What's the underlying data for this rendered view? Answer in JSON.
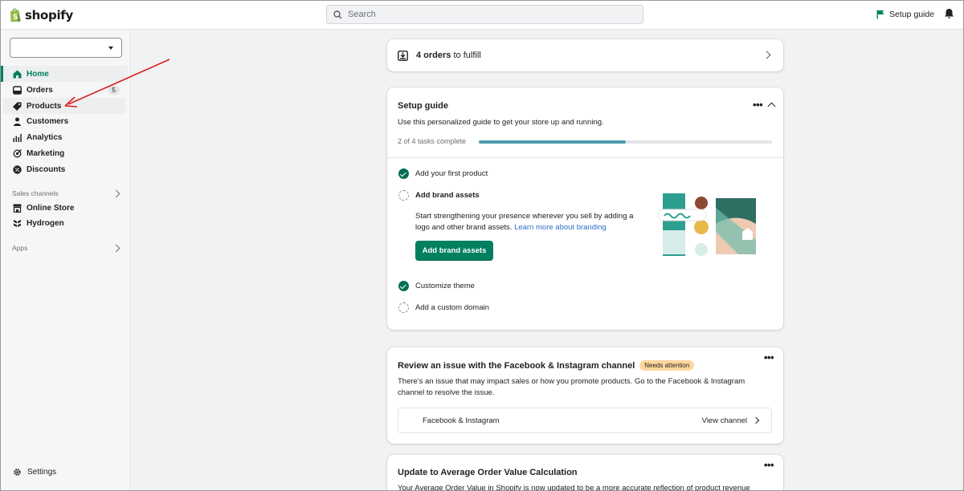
{
  "topbar": {
    "brand": "shopify",
    "search_placeholder": "Search",
    "setup_guide_label": "Setup guide"
  },
  "sidebar": {
    "items": [
      {
        "label": "Home",
        "icon": "home-icon",
        "active": true
      },
      {
        "label": "Orders",
        "icon": "orders-icon",
        "badge": "5"
      },
      {
        "label": "Products",
        "icon": "tag-icon"
      },
      {
        "label": "Customers",
        "icon": "person-icon"
      },
      {
        "label": "Analytics",
        "icon": "bar-chart-icon"
      },
      {
        "label": "Marketing",
        "icon": "target-icon"
      },
      {
        "label": "Discounts",
        "icon": "discount-icon"
      }
    ],
    "sales_channels_label": "Sales channels",
    "channels": [
      {
        "label": "Online Store",
        "icon": "store-icon"
      },
      {
        "label": "Hydrogen",
        "icon": "hydrogen-icon"
      }
    ],
    "apps_label": "Apps",
    "settings_label": "Settings"
  },
  "orders_card": {
    "count_text": "4 orders",
    "suffix": "to fulfill"
  },
  "setup_guide": {
    "title": "Setup guide",
    "description": "Use this personalized guide to get your store up and running.",
    "progress_text": "2 of 4 tasks complete",
    "progress_fraction": 0.5,
    "tasks": [
      {
        "label": "Add your first product",
        "done": true
      },
      {
        "label": "Add brand assets",
        "done": false
      },
      {
        "label": "Customize theme",
        "done": true
      },
      {
        "label": "Add a custom domain",
        "done": false
      }
    ],
    "brand_assets_desc": "Start strengthening your presence wherever you sell by adding a logo and other brand assets.",
    "brand_assets_link": "Learn more about branding",
    "brand_assets_button": "Add brand assets"
  },
  "facebook_card": {
    "title": "Review an issue with the Facebook & Instagram channel",
    "badge": "Needs attention",
    "description": "There's an issue that may impact sales or how you promote products. Go to the Facebook & Instagram channel to resolve the issue.",
    "channel_label": "Facebook & Instagram",
    "view_link": "View channel"
  },
  "aov_card": {
    "title": "Update to Average Order Value Calculation",
    "description": "Your Average Order Value in Shopify is now updated to be a more accurate reflection of product revenue"
  },
  "colors": {
    "brand_green": "#008060",
    "active_nav": "#007f5f",
    "progress": "#4a9bad",
    "attention_badge": "#ffd79d",
    "annotation_arrow": "#d9201c"
  }
}
